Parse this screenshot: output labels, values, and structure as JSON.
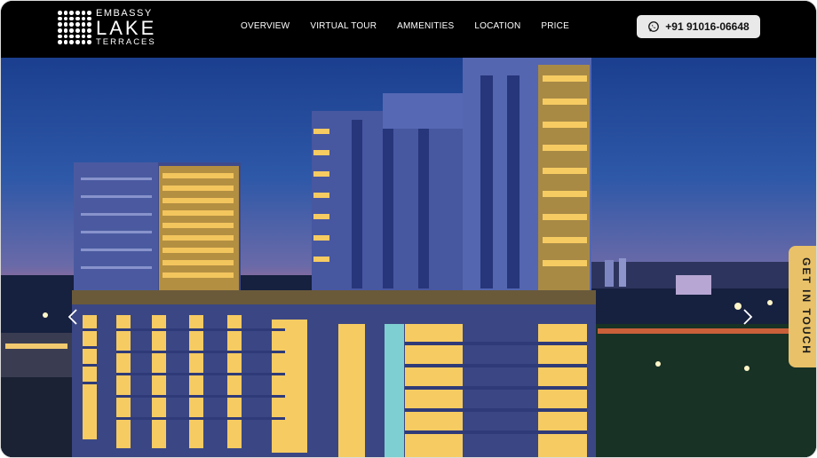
{
  "brand": {
    "line1": "EMBASSY",
    "line2": "LAKE",
    "line3": "TERRACES"
  },
  "nav": {
    "items": [
      {
        "label": "OVERVIEW"
      },
      {
        "label": "VIRTUAL TOUR"
      },
      {
        "label": "AMMENITIES"
      },
      {
        "label": "LOCATION"
      },
      {
        "label": "PRICE"
      }
    ]
  },
  "contact": {
    "phone": "+91 91016-06648",
    "icon": "whatsapp-icon"
  },
  "hero": {
    "prev_icon": "chevron-left-icon",
    "next_icon": "chevron-right-icon"
  },
  "cta": {
    "label": "GET IN TOUCH"
  },
  "colors": {
    "navbar": "#000000",
    "cta": "#e8c169",
    "phone_bg": "#e9e9e9"
  }
}
